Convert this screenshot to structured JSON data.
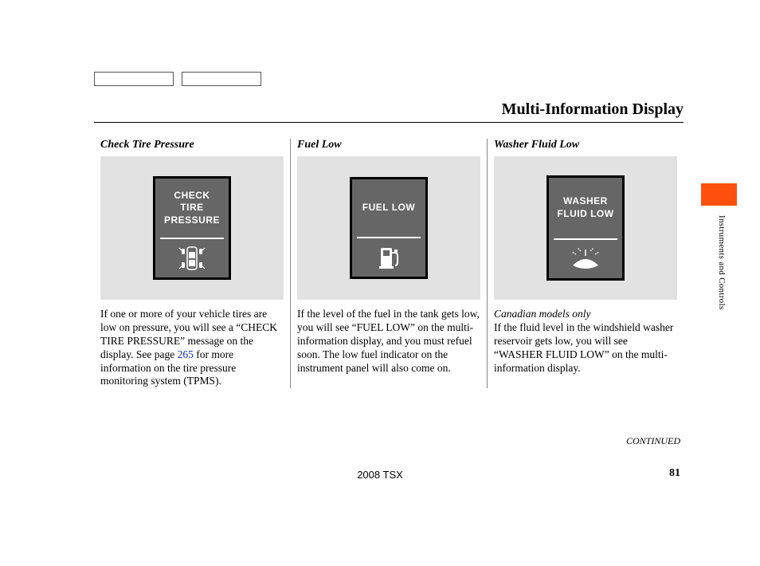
{
  "page_title": "Multi-Information Display",
  "side_label": "Instruments and Controls",
  "continued_label": "CONTINUED",
  "footer_model": "2008  TSX",
  "footer_page": "81",
  "columns": [
    {
      "heading": "Check Tire Pressure",
      "display_text": "CHECK\nTIRE\nPRESSURE",
      "body_pre": "If one or more of your vehicle tires are low on pressure, you will see a “CHECK TIRE PRESSURE” message on the display. See page ",
      "link": "265",
      "body_post": " for more information on the tire pressure monitoring system (TPMS)."
    },
    {
      "heading": "Fuel Low",
      "display_text": "FUEL LOW",
      "body": "If the level of the fuel in the tank gets low, you will see “FUEL LOW” on the multi-information display, and you must refuel soon. The low fuel indicator on the instrument panel will also come on."
    },
    {
      "heading": "Washer Fluid Low",
      "display_text": "WASHER\nFLUID LOW",
      "note": "Canadian models only",
      "body": "If the fluid level in the windshield washer reservoir gets low, you will see “WASHER FLUID LOW” on the multi-information display."
    }
  ]
}
